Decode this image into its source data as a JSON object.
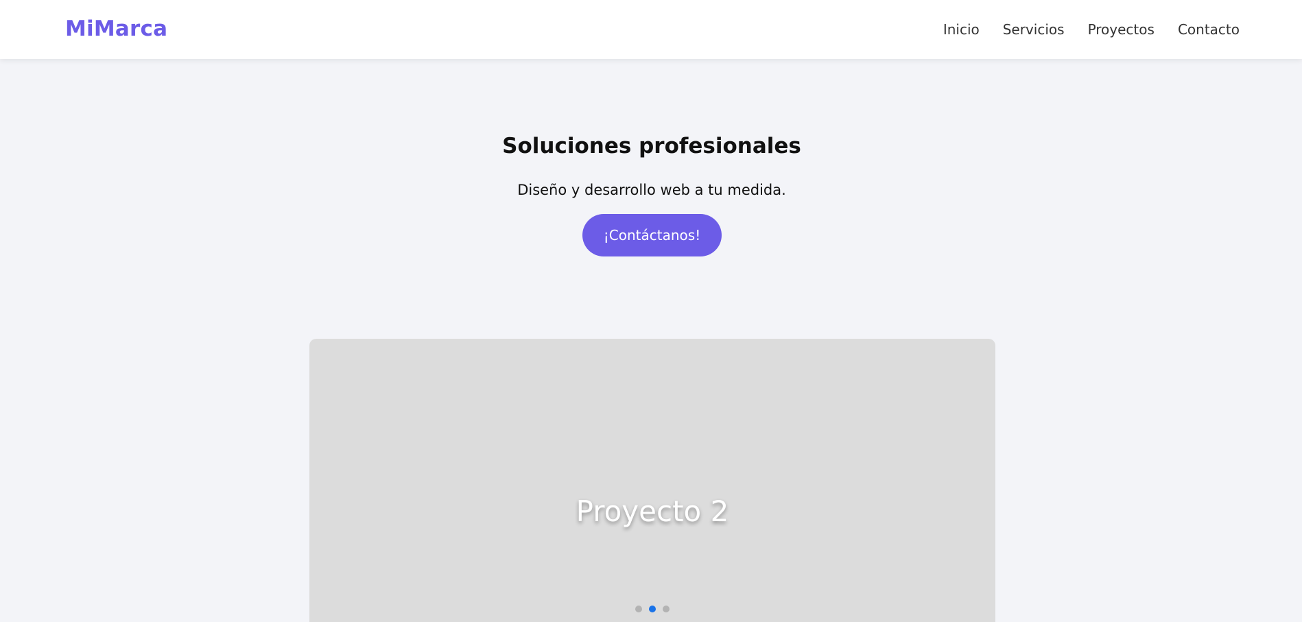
{
  "header": {
    "logo": "MiMarca",
    "nav": [
      {
        "label": "Inicio"
      },
      {
        "label": "Servicios"
      },
      {
        "label": "Proyectos"
      },
      {
        "label": "Contacto"
      }
    ]
  },
  "hero": {
    "title": "Soluciones profesionales",
    "subtitle": "Diseño y desarrollo web a tu medida.",
    "cta_label": "¡Contáctanos!"
  },
  "carousel": {
    "slide_title": "Proyecto 2",
    "slide_count": 3,
    "active_index": 1
  },
  "colors": {
    "accent": "#6c5ce7",
    "active_dot": "#1a73e8",
    "inactive_dot": "#b3b3b3",
    "page_background": "#f3f4f8",
    "slide_background": "#dcdcdc"
  }
}
